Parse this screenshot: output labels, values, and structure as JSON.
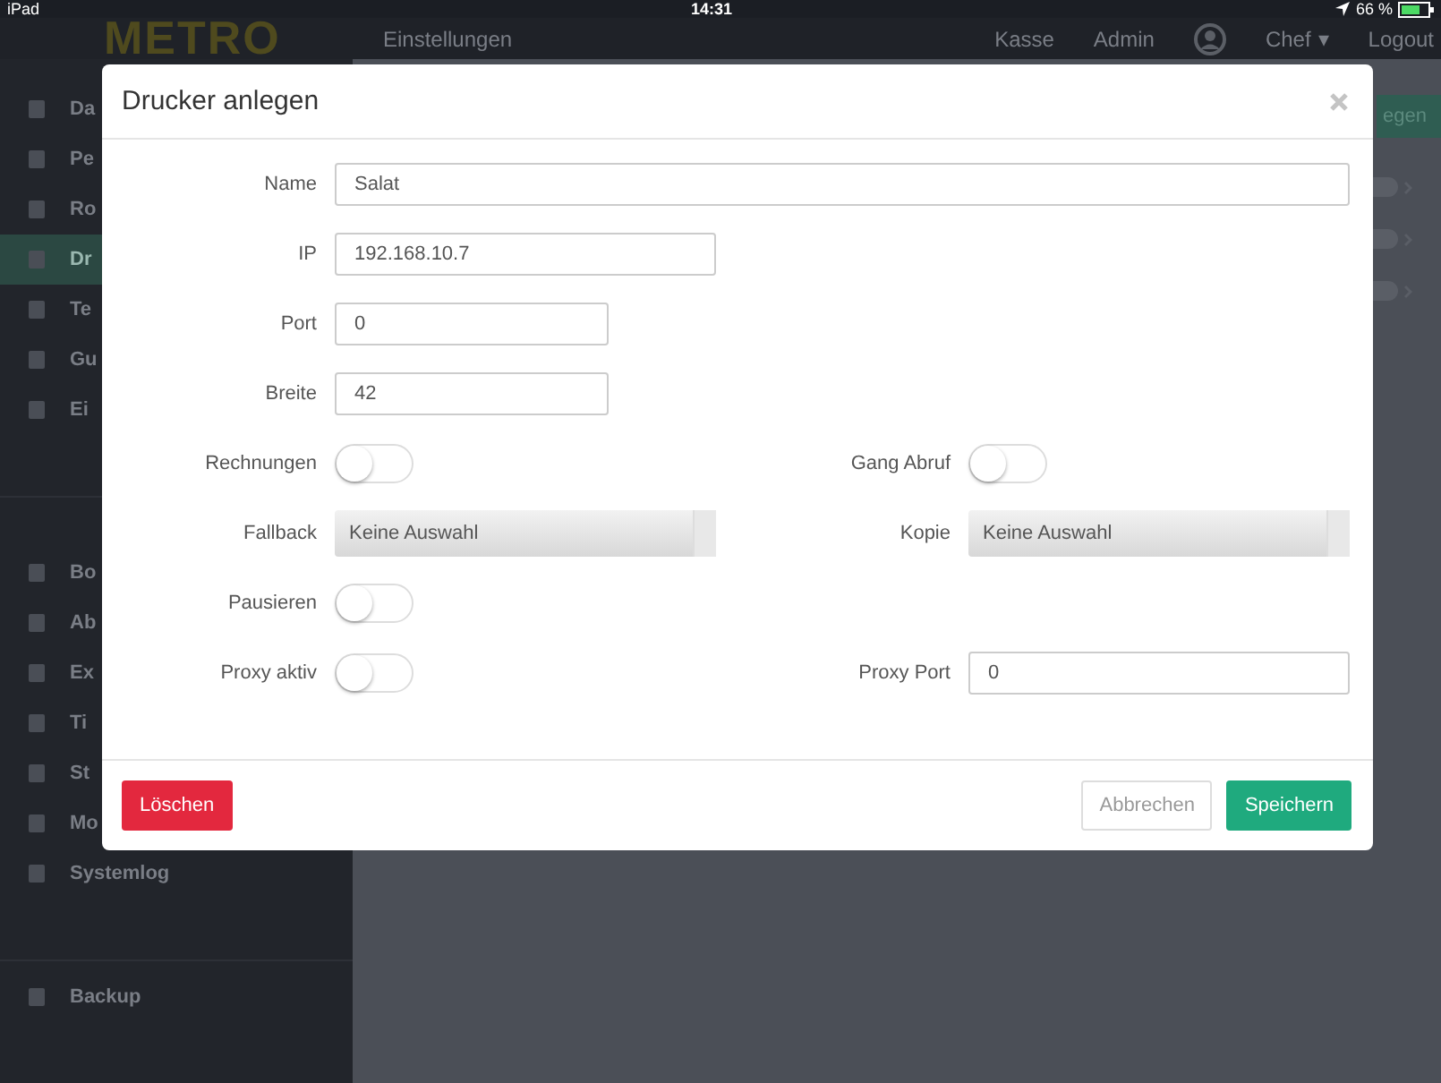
{
  "status_bar": {
    "device": "iPad",
    "time": "14:31",
    "battery": "66 %"
  },
  "header": {
    "logo": "METRO",
    "section": "Einstellungen",
    "links": [
      "Kasse",
      "Admin"
    ],
    "user": "Chef",
    "user_caret": "▾",
    "logout": "Logout"
  },
  "sidebar": {
    "groups": [
      {
        "items": [
          {
            "label": "Da",
            "selected": false
          },
          {
            "label": "Pe",
            "selected": false
          },
          {
            "label": "Ro",
            "selected": false
          },
          {
            "label": "Dr",
            "selected": true
          },
          {
            "label": "Te",
            "selected": false
          },
          {
            "label": "Gu",
            "selected": false
          },
          {
            "label": "Ei",
            "selected": false
          }
        ]
      },
      {
        "items": [
          {
            "label": "Bo",
            "selected": false
          },
          {
            "label": "Ab",
            "selected": false
          },
          {
            "label": "Ex",
            "selected": false
          },
          {
            "label": "Ti",
            "selected": false
          },
          {
            "label": "St",
            "selected": false
          },
          {
            "label": "Mo",
            "selected": false
          },
          {
            "label": "Systemlog",
            "selected": false
          }
        ]
      },
      {
        "items": [
          {
            "label": "Backup",
            "selected": false
          }
        ]
      }
    ]
  },
  "content": {
    "button": "egen"
  },
  "dialog": {
    "title": "Drucker anlegen",
    "rows": [
      {
        "fields": [
          {
            "kind": "text-wide",
            "label": "Name",
            "value": "Salat"
          }
        ]
      },
      {
        "fields": [
          {
            "kind": "text-wide",
            "label": "IP",
            "value": "192.168.10.7"
          }
        ]
      },
      {
        "fields": [
          {
            "kind": "text",
            "label": "Port",
            "value": "0"
          }
        ]
      },
      {
        "fields": [
          {
            "kind": "text",
            "label": "Breite",
            "value": "42"
          }
        ]
      },
      {
        "fields": [
          {
            "kind": "toggle",
            "label": "Rechnungen",
            "on": false
          },
          {
            "kind": "toggle",
            "label": "Gang Abruf",
            "on": false
          }
        ]
      },
      {
        "fields": [
          {
            "kind": "select",
            "label": "Fallback",
            "value": "Keine Auswahl"
          },
          {
            "kind": "select",
            "label": "Kopie",
            "value": "Keine Auswahl"
          }
        ]
      },
      {
        "fields": [
          {
            "kind": "toggle",
            "label": "Pausieren",
            "on": false
          }
        ]
      },
      {
        "fields": [
          {
            "kind": "toggle",
            "label": "Proxy aktiv",
            "on": false
          },
          {
            "kind": "text",
            "label": "Proxy Port",
            "value": "0"
          }
        ]
      }
    ],
    "delete": "Löschen",
    "cancel": "Abbrechen",
    "save": "Speichern"
  }
}
